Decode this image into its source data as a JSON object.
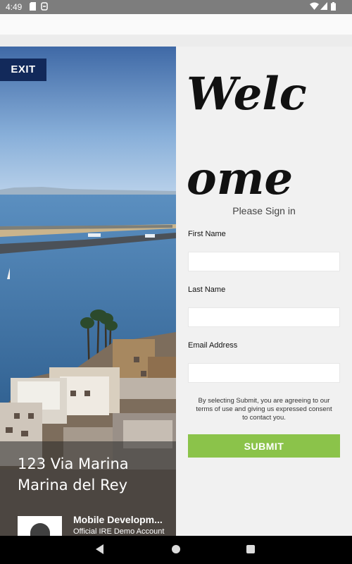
{
  "status_bar": {
    "time": "4:49",
    "icons": [
      "sd-card-icon",
      "sync-icon",
      "wifi-icon",
      "signal-icon",
      "battery-icon"
    ]
  },
  "listing": {
    "exit_label": "EXIT",
    "address_line1": "123 Via Marina",
    "address_line2": "Marina del Rey",
    "agent_name": "Mobile Developm...",
    "agent_account": "Official IRE Demo Account"
  },
  "form": {
    "welcome": "Welcome",
    "subtitle": "Please Sign in",
    "first_name_label": "First Name",
    "first_name_value": "",
    "last_name_label": "Last Name",
    "last_name_value": "",
    "email_label": "Email Address",
    "email_value": "",
    "consent_text": "By selecting Submit, you are agreeing to our terms of use and giving us expressed consent to contact you.",
    "submit_label": "SUBMIT"
  },
  "colors": {
    "exit_bg": "#12295a",
    "submit_bg": "#8bc34a",
    "panel_bg": "#f1f1f1"
  },
  "nav_bar": {
    "icons": [
      "back-icon",
      "home-icon",
      "recents-icon"
    ]
  }
}
